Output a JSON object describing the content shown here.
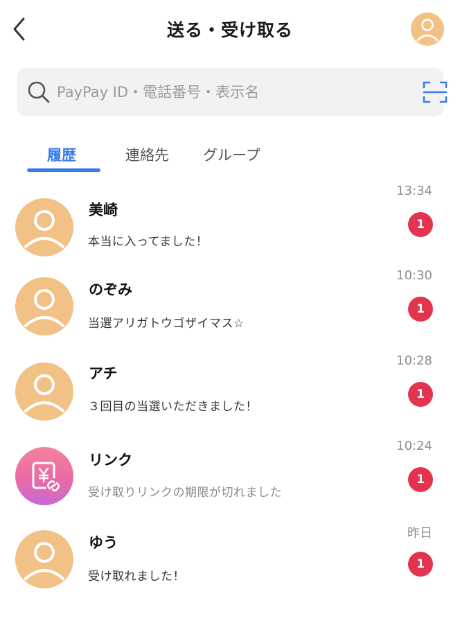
{
  "header": {
    "title": "送る・受け取る",
    "back_icon": "chevron-left-icon",
    "profile_icon": "user-avatar-icon"
  },
  "search": {
    "placeholder": "PayPay ID・電話番号・表示名",
    "value": "",
    "scan_icon": "scan-icon"
  },
  "tabs": [
    {
      "label": "履歴",
      "active": true
    },
    {
      "label": "連絡先",
      "active": false
    },
    {
      "label": "グループ",
      "active": false
    }
  ],
  "conversations": [
    {
      "name": "美崎",
      "message": "本当に入ってました！",
      "time": "13:34",
      "unread": "1",
      "avatar": "person-icon"
    },
    {
      "name": "のぞみ",
      "message": "当選アリガトウゴザイマス☆",
      "time": "10:30",
      "unread": "1",
      "avatar": "person-icon"
    },
    {
      "name": "アチ",
      "message": "３回目の当選いただきました！",
      "time": "10:28",
      "unread": "1",
      "avatar": "person-icon"
    },
    {
      "name": "リンク",
      "message": "受け取りリンクの期限が切れました",
      "time": "10:24",
      "unread": "1",
      "avatar": "yen-link-icon"
    },
    {
      "name": "ゆう",
      "message": "受け取れました！",
      "time": "昨日",
      "unread": "1",
      "avatar": "person-icon"
    }
  ],
  "colors": {
    "accent": "#3a7de8",
    "badge": "#e2344e",
    "avatar": "#f2c185",
    "link_avatar_gradient": [
      "#f5829a",
      "#ea6aa6",
      "#c66ad4"
    ]
  }
}
